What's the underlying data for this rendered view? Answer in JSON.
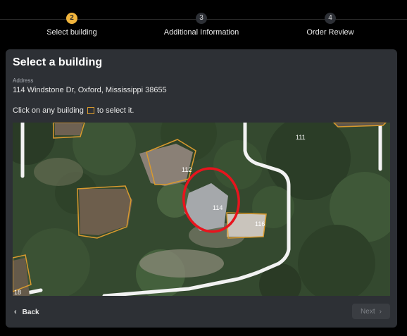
{
  "stepper": {
    "steps": [
      {
        "number": "2",
        "label": "Select building",
        "active": true
      },
      {
        "number": "3",
        "label": "Additional Information",
        "active": false
      },
      {
        "number": "4",
        "label": "Order Review",
        "active": false
      }
    ]
  },
  "card": {
    "title": "Select a building",
    "address_label": "Address",
    "address_value": "114 Windstone Dr, Oxford, Mississippi 38655",
    "hint_before": "Click on any building",
    "hint_after": "to select it."
  },
  "map": {
    "building_labels": [
      "111",
      "112",
      "114",
      "116",
      "18"
    ],
    "outline_color": "#d99a2e",
    "selection_color": "#e8141d",
    "road_color": "#f2f2f2"
  },
  "footer": {
    "back_label": "Back",
    "next_label": "Next",
    "next_disabled": true
  }
}
